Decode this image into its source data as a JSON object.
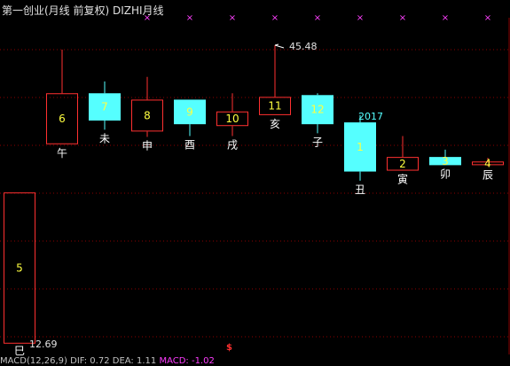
{
  "header": {
    "title": "第一创业(月线 前复权) DIZHI月线",
    "markers": [
      "×",
      "×",
      "×",
      "×",
      "×",
      "×",
      "×",
      "×",
      "×",
      "×",
      "×"
    ]
  },
  "colors": {
    "background": "#000000",
    "up": "#ff3030",
    "down": "#55ffff",
    "marker": "#ff40ff",
    "grid": "#8b0000",
    "number_up": "#ffff40",
    "text": "#e0e0e0"
  },
  "chart_data": {
    "type": "candlestick",
    "title": "第一创业(月线 前复权) DIZHI月线",
    "candles": [
      {
        "branch": "巳",
        "num": "5",
        "direction": "up",
        "open": 12.69,
        "close": 29.3,
        "high": 29.3,
        "low": 12.69
      },
      {
        "branch": "午",
        "num": "6",
        "direction": "up",
        "open": 34.6,
        "close": 40.2,
        "high": 45.0,
        "low": 34.6
      },
      {
        "branch": "未",
        "num": "7",
        "direction": "down",
        "open": 40.2,
        "close": 37.2,
        "high": 41.5,
        "low": 36.2
      },
      {
        "branch": "申",
        "num": "8",
        "direction": "up",
        "open": 36.0,
        "close": 39.5,
        "high": 42.0,
        "low": 35.4
      },
      {
        "branch": "酉",
        "num": "9",
        "direction": "down",
        "open": 39.5,
        "close": 36.8,
        "high": 39.5,
        "low": 35.5
      },
      {
        "branch": "戌",
        "num": "10",
        "direction": "up",
        "open": 36.6,
        "close": 38.2,
        "high": 40.2,
        "low": 35.5
      },
      {
        "branch": "亥",
        "num": "11",
        "direction": "up",
        "open": 37.8,
        "close": 39.8,
        "high": 45.48,
        "low": 37.8
      },
      {
        "branch": "子",
        "num": "12",
        "direction": "down",
        "open": 40.0,
        "close": 36.8,
        "high": 40.2,
        "low": 35.8
      },
      {
        "branch": "丑",
        "num": "1",
        "direction": "down",
        "open": 37.0,
        "close": 31.6,
        "high": 37.8,
        "low": 30.6
      },
      {
        "branch": "寅",
        "num": "2",
        "direction": "up",
        "open": 31.7,
        "close": 33.2,
        "high": 35.5,
        "low": 31.7
      },
      {
        "branch": "卯",
        "num": "3",
        "direction": "down",
        "open": 33.2,
        "close": 32.3,
        "high": 34.0,
        "low": 32.3
      },
      {
        "branch": "辰",
        "num": "4",
        "direction": "up",
        "open": 32.3,
        "close": 32.7,
        "high": 33.1,
        "low": 32.2
      }
    ],
    "annotations": {
      "high_value": "45.48",
      "low_value": "12.69",
      "year_label": "2017"
    },
    "ylim": [
      11.5,
      48.5
    ],
    "grid": true
  },
  "footer": {
    "dollar": "$",
    "text_plain": "MACD(12,26,9) DIF: 0.72 DEA: 1.11",
    "text_pink": "MACD: -1.02"
  }
}
